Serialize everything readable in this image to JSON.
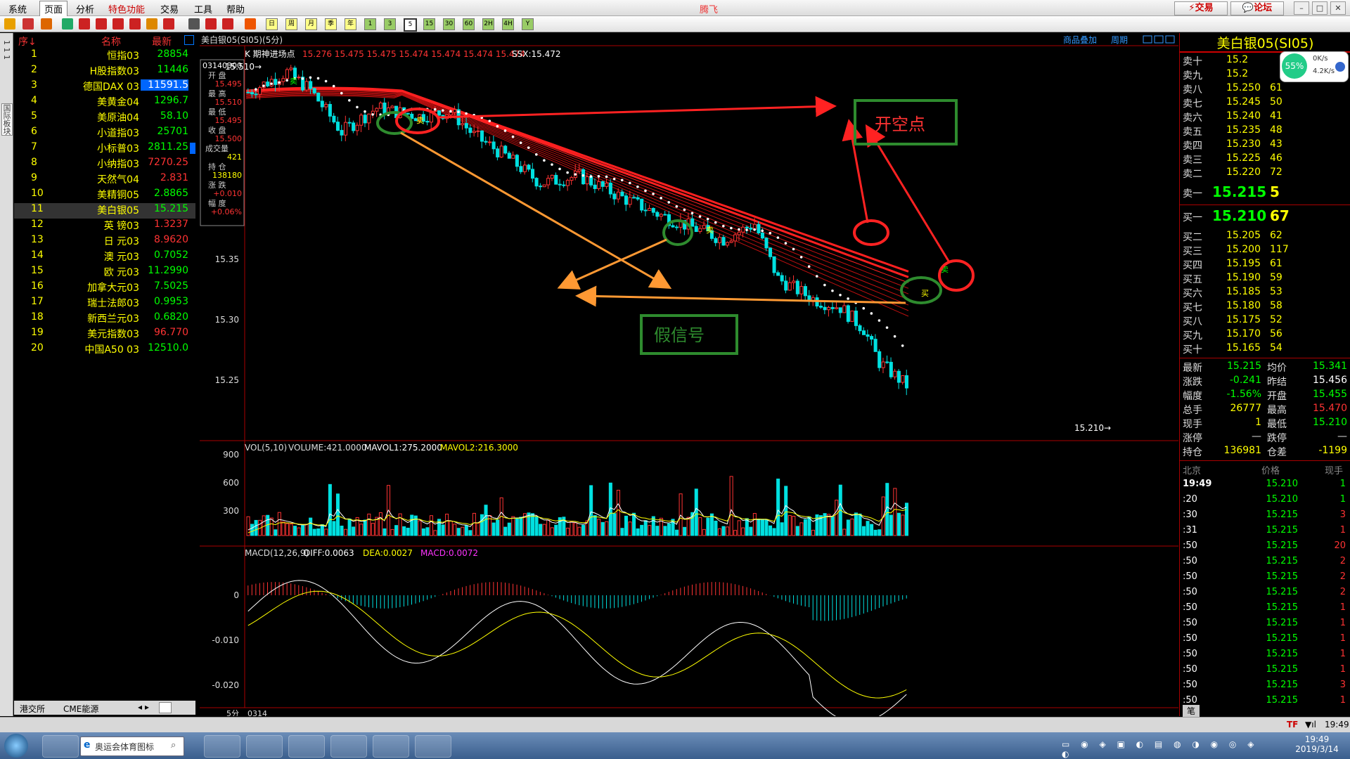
{
  "app": {
    "title": "腾飞"
  },
  "menu": [
    "系统",
    "页面",
    "分析",
    "特色功能",
    "交易",
    "工具",
    "帮助"
  ],
  "top_buttons": {
    "trade": "交易",
    "forum": "论坛"
  },
  "toolbar": {
    "periods": [
      "日",
      "周",
      "月",
      "季",
      "年",
      "1",
      "3",
      "5",
      "15",
      "30",
      "60",
      "2H",
      "4H",
      "Y"
    ]
  },
  "side_tab": {
    "label1": "国际板块"
  },
  "quote_table": {
    "headers": {
      "seq": "序↓",
      "name": "名称",
      "last": "最新"
    },
    "rows": [
      {
        "num": "1",
        "name": "恒指03",
        "val": "28854",
        "color": "#0f0"
      },
      {
        "num": "2",
        "name": "H股指数03",
        "val": "11446",
        "color": "#0f0"
      },
      {
        "num": "3",
        "name": "德国DAX 03",
        "val": "11591.5",
        "color": "#fff",
        "hl": true
      },
      {
        "num": "4",
        "name": "美黄金04",
        "val": "1296.7",
        "color": "#0f0"
      },
      {
        "num": "5",
        "name": "美原油04",
        "val": "58.10",
        "color": "#0f0"
      },
      {
        "num": "6",
        "name": "小道指03",
        "val": "25701",
        "color": "#0f0"
      },
      {
        "num": "7",
        "name": "小标普03",
        "val": "2811.25",
        "color": "#0f0"
      },
      {
        "num": "8",
        "name": "小纳指03",
        "val": "7270.25",
        "color": "#f33"
      },
      {
        "num": "9",
        "name": "天然气04",
        "val": "2.831",
        "color": "#f33"
      },
      {
        "num": "10",
        "name": "美精铜05",
        "val": "2.8865",
        "color": "#0f0"
      },
      {
        "num": "11",
        "name": "美白银05",
        "val": "15.215",
        "color": "#0f0",
        "sel": true
      },
      {
        "num": "12",
        "name": "英  镑03",
        "val": "1.3237",
        "color": "#f33"
      },
      {
        "num": "13",
        "name": "日  元03",
        "val": "8.9620",
        "color": "#f33"
      },
      {
        "num": "14",
        "name": "澳  元03",
        "val": "0.7052",
        "color": "#0f0"
      },
      {
        "num": "15",
        "name": "欧  元03",
        "val": "11.2990",
        "color": "#0f0"
      },
      {
        "num": "16",
        "name": "加拿大元03",
        "val": "7.5025",
        "color": "#0f0"
      },
      {
        "num": "17",
        "name": "瑞士法郎03",
        "val": "0.9953",
        "color": "#0f0"
      },
      {
        "num": "18",
        "name": "新西兰元03",
        "val": "0.6820",
        "color": "#0f0"
      },
      {
        "num": "19",
        "name": "美元指数03",
        "val": "96.770",
        "color": "#f33"
      },
      {
        "num": "20",
        "name": "中国A50 03",
        "val": "12510.0",
        "color": "#0f0"
      }
    ],
    "footer_tabs": [
      "港交所",
      "CME能源"
    ]
  },
  "chart": {
    "title": "美白银05(SI05)(5分)",
    "links": {
      "overlay": "商品叠加",
      "period": "周期"
    },
    "indicator_line": "K  期神进场点",
    "indicator_values": "15.276 15.475 15.475 15.474 15.474 15.474 15.474",
    "ssx": "SSX:15.472",
    "info_box": {
      "date": "03140300",
      "open_label": "开  盘",
      "open": "15.495",
      "high_label": "最  高",
      "high": "15.510",
      "low_label": "最  低",
      "low": "15.495",
      "close_label": "收  盘",
      "close": "15.500",
      "vol_label": "成交量",
      "vol": "421",
      "oi_label": "持  仓",
      "oi": "138180",
      "chg_label": "涨  跌",
      "chg": "+0.010",
      "pct_label": "幅  度",
      "pct": "+0.06%"
    },
    "price_ticks": [
      "15.35",
      "15.30",
      "15.25"
    ],
    "high_marker": "15.510→",
    "low_marker": "15.210→",
    "annotations": {
      "short_point": "开空点",
      "fake_signal": "假信号",
      "sell": "卖",
      "buy": "买"
    },
    "vol_header": {
      "name": "VOL(5,10)",
      "volume": "VOLUME:421.0000",
      "mavol1": "MAVOL1:275.2000",
      "mavol2": "MAVOL2:216.3000"
    },
    "vol_ticks": [
      "900",
      "600",
      "300"
    ],
    "macd_header": {
      "name": "MACD(12,26,9)",
      "diff": "DIFF:0.0063",
      "dea": "DEA:0.0027",
      "macd": "MACD:0.0072"
    },
    "macd_ticks": [
      "0",
      "-0.010",
      "-0.020"
    ],
    "footer": {
      "period": "5分",
      "date": "0314"
    }
  },
  "right_panel": {
    "title": "美白银05(SI05)",
    "net": {
      "pct": "55%",
      "up": "0K/s",
      "down": "4.2K/s"
    },
    "asks": [
      {
        "l": "卖十",
        "p": "15.2",
        "v": ""
      },
      {
        "l": "卖九",
        "p": "15.2",
        "v": ""
      },
      {
        "l": "卖八",
        "p": "15.250",
        "v": "61"
      },
      {
        "l": "卖七",
        "p": "15.245",
        "v": "50"
      },
      {
        "l": "卖六",
        "p": "15.240",
        "v": "41"
      },
      {
        "l": "卖五",
        "p": "15.235",
        "v": "48"
      },
      {
        "l": "卖四",
        "p": "15.230",
        "v": "43"
      },
      {
        "l": "卖三",
        "p": "15.225",
        "v": "46"
      },
      {
        "l": "卖二",
        "p": "15.220",
        "v": "72"
      }
    ],
    "ask1": {
      "l": "卖一",
      "p": "15.215",
      "v": "5"
    },
    "bid1": {
      "l": "买一",
      "p": "15.210",
      "v": "67"
    },
    "bids": [
      {
        "l": "买二",
        "p": "15.205",
        "v": "62"
      },
      {
        "l": "买三",
        "p": "15.200",
        "v": "117"
      },
      {
        "l": "买四",
        "p": "15.195",
        "v": "61"
      },
      {
        "l": "买五",
        "p": "15.190",
        "v": "59"
      },
      {
        "l": "买六",
        "p": "15.185",
        "v": "53"
      },
      {
        "l": "买七",
        "p": "15.180",
        "v": "58"
      },
      {
        "l": "买八",
        "p": "15.175",
        "v": "52"
      },
      {
        "l": "买九",
        "p": "15.170",
        "v": "56"
      },
      {
        "l": "买十",
        "p": "15.165",
        "v": "54"
      }
    ],
    "stats": [
      {
        "l1": "最新",
        "v1": "15.215",
        "c1": "#0f0",
        "l2": "均价",
        "v2": "15.341",
        "c2": "#0f0"
      },
      {
        "l1": "涨跌",
        "v1": "-0.241",
        "c1": "#0f0",
        "l2": "昨结",
        "v2": "15.456",
        "c2": "#fff"
      },
      {
        "l1": "幅度",
        "v1": "-1.56%",
        "c1": "#0f0",
        "l2": "开盘",
        "v2": "15.455",
        "c2": "#0f0"
      },
      {
        "l1": "总手",
        "v1": "26777",
        "c1": "#ff0",
        "l2": "最高",
        "v2": "15.470",
        "c2": "#f33"
      },
      {
        "l1": "现手",
        "v1": "1",
        "c1": "#ff0",
        "l2": "最低",
        "v2": "15.210",
        "c2": "#0f0"
      },
      {
        "l1": "涨停",
        "v1": "—",
        "c1": "#ddd",
        "l2": "跌停",
        "v2": "—",
        "c2": "#ddd"
      },
      {
        "l1": "持仓",
        "v1": "136981",
        "c1": "#ff0",
        "l2": "仓差",
        "v2": "-1199",
        "c2": "#ff0"
      }
    ],
    "ticks_header": {
      "time": "北京",
      "price": "价格",
      "vol": "现手"
    },
    "ticks": [
      {
        "t": "19:49",
        "p": "15.210",
        "v": "1",
        "c": "#0f0"
      },
      {
        "t": ":20",
        "p": "15.210",
        "v": "1",
        "c": "#0f0"
      },
      {
        "t": ":30",
        "p": "15.215",
        "v": "3",
        "c": "#f33"
      },
      {
        "t": ":31",
        "p": "15.215",
        "v": "1",
        "c": "#f33"
      },
      {
        "t": ":50",
        "p": "15.215",
        "v": "20",
        "c": "#f33"
      },
      {
        "t": ":50",
        "p": "15.215",
        "v": "2",
        "c": "#f33"
      },
      {
        "t": ":50",
        "p": "15.215",
        "v": "2",
        "c": "#f33"
      },
      {
        "t": ":50",
        "p": "15.215",
        "v": "2",
        "c": "#f33"
      },
      {
        "t": ":50",
        "p": "15.215",
        "v": "1",
        "c": "#f33"
      },
      {
        "t": ":50",
        "p": "15.215",
        "v": "1",
        "c": "#f33"
      },
      {
        "t": ":50",
        "p": "15.215",
        "v": "1",
        "c": "#f33"
      },
      {
        "t": ":50",
        "p": "15.215",
        "v": "1",
        "c": "#f33"
      },
      {
        "t": ":50",
        "p": "15.215",
        "v": "1",
        "c": "#f33"
      },
      {
        "t": ":50",
        "p": "15.215",
        "v": "3",
        "c": "#f33"
      },
      {
        "t": ":50",
        "p": "15.215",
        "v": "1",
        "c": "#f33"
      }
    ],
    "bottom_tab": "笔"
  },
  "statusbar": {
    "time": "19:49"
  },
  "taskbar": {
    "search_placeholder": "奥运会体育图标",
    "clock_time": "19:49",
    "clock_date": "2019/3/14"
  },
  "colors": {
    "up": "#ff3333",
    "down": "#00e0e0",
    "bg": "#000000",
    "border": "#aa0000",
    "ma": "#ff2020",
    "annot_green": "#2e8b2e"
  }
}
